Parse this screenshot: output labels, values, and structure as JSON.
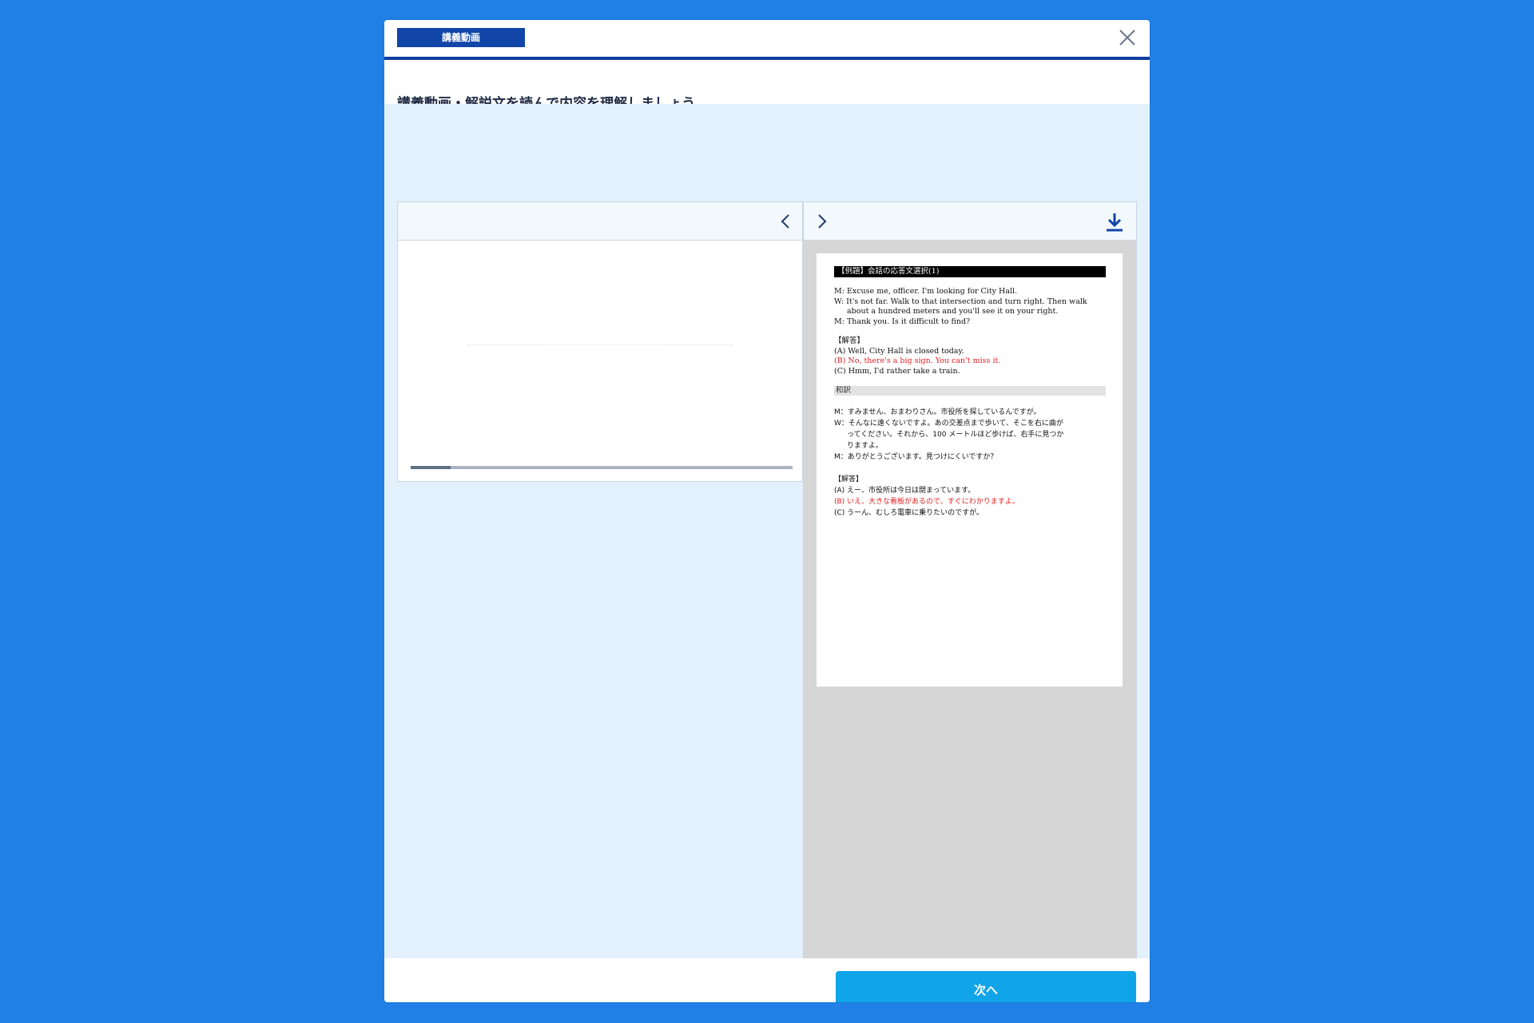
{
  "header": {
    "badge": "講義動画",
    "close_icon": "close-icon"
  },
  "instruction": "講義動画・解説文を読んで内容を理解しましょう。",
  "toolbar": {
    "prev_icon": "chevron-left-icon",
    "next_icon": "chevron-right-icon",
    "download_icon": "download-icon"
  },
  "video": {
    "progress": 0.105
  },
  "document": {
    "title": "【例題】会話の応答文選択(1)",
    "dialogue": [
      "M: Excuse me, officer. I'm looking for City Hall.",
      "W: It's not far. Walk to that intersection and turn right. Then walk",
      "about a hundred meters and you'll see it on your right.",
      "M: Thank you. Is it difficult to find?"
    ],
    "answer_heading": "【解答】",
    "answers": [
      "(A) Well, City Hall is closed today.",
      "(B) No, there's a big sign. You can't miss it.",
      "(C) Hmm, I'd rather take a train."
    ],
    "translation_heading": "和訳",
    "translation": [
      "M：すみません、おまわりさん。市役所を探しているんですが。",
      "W：そんなに遠くないですよ。あの交差点まで歩いて、そこを右に曲が",
      "ってください。それから、100 メートルほど歩けば、右手に見つか",
      "りますよ。",
      "M：ありがとうございます。見つけにくいですか？"
    ],
    "answer_heading_ja": "【解答】",
    "answers_ja": [
      "(A) えー、市役所は今日は閉まっています。",
      "(B) いえ、大きな看板があるので、すぐにわかりますよ。",
      "(C) うーん、むしろ電車に乗りたいのですが。"
    ],
    "highlight_color": "#e02020"
  },
  "footer": {
    "next_label": "次へ"
  },
  "colors": {
    "background": "#2080e6",
    "accent": "#1245a8",
    "button": "#10a4e8"
  }
}
